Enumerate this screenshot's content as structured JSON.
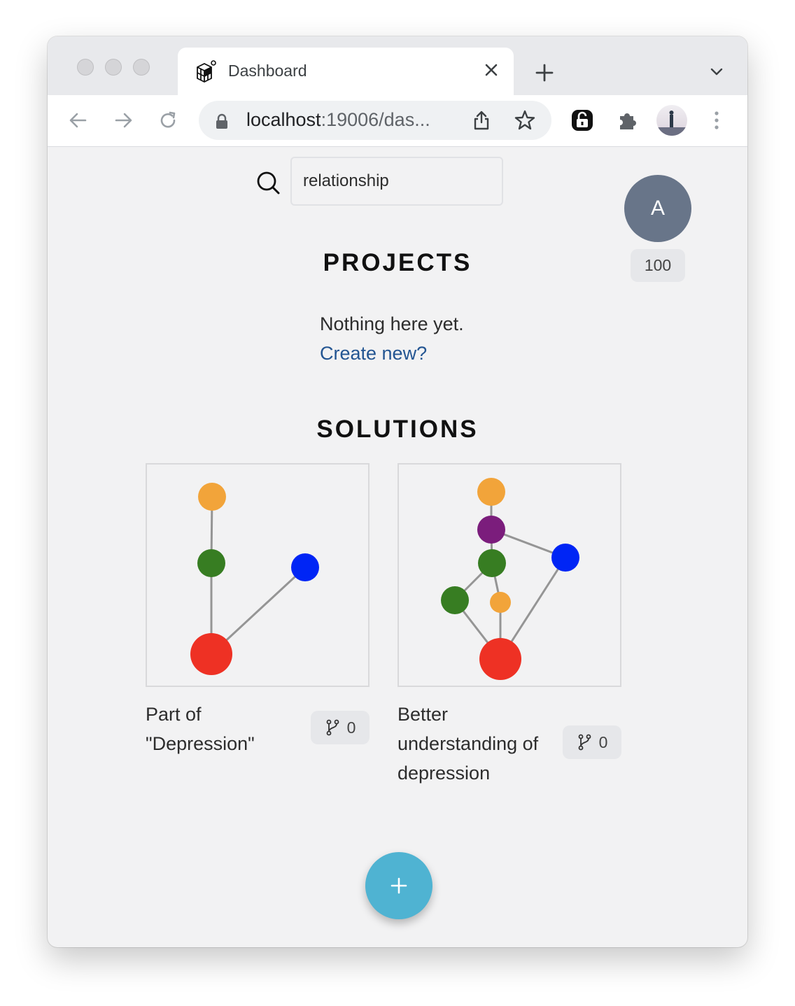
{
  "browser": {
    "tab_title": "Dashboard",
    "url_host": "localhost",
    "url_path": ":19006/das..."
  },
  "search": {
    "value": "relationship"
  },
  "user": {
    "avatar_letter": "A",
    "points": "100"
  },
  "projects": {
    "heading": "PROJECTS",
    "empty_text": "Nothing here yet.",
    "create_link": "Create new?"
  },
  "solutions": {
    "heading": "SOLUTIONS",
    "items": [
      {
        "title": "Part of \"Depression\"",
        "fork_count": "0",
        "nodes": [
          {
            "color": "#f2a43a"
          },
          {
            "color": "#377d22"
          },
          {
            "color": "#0025f5"
          },
          {
            "color": "#ee3124"
          }
        ]
      },
      {
        "title": "Better understanding of depression",
        "fork_count": "0",
        "nodes": [
          {
            "color": "#f2a43a"
          },
          {
            "color": "#7b1d7c"
          },
          {
            "color": "#377d22"
          },
          {
            "color": "#0025f5"
          },
          {
            "color": "#377d22"
          },
          {
            "color": "#f2a43a"
          },
          {
            "color": "#ee3124"
          }
        ]
      }
    ]
  },
  "fab": {
    "icon": "plus-icon",
    "color": "#4fb3d2"
  },
  "colors": {
    "link": "#235592",
    "avatar": "#687589",
    "background": "#f2f2f3"
  }
}
